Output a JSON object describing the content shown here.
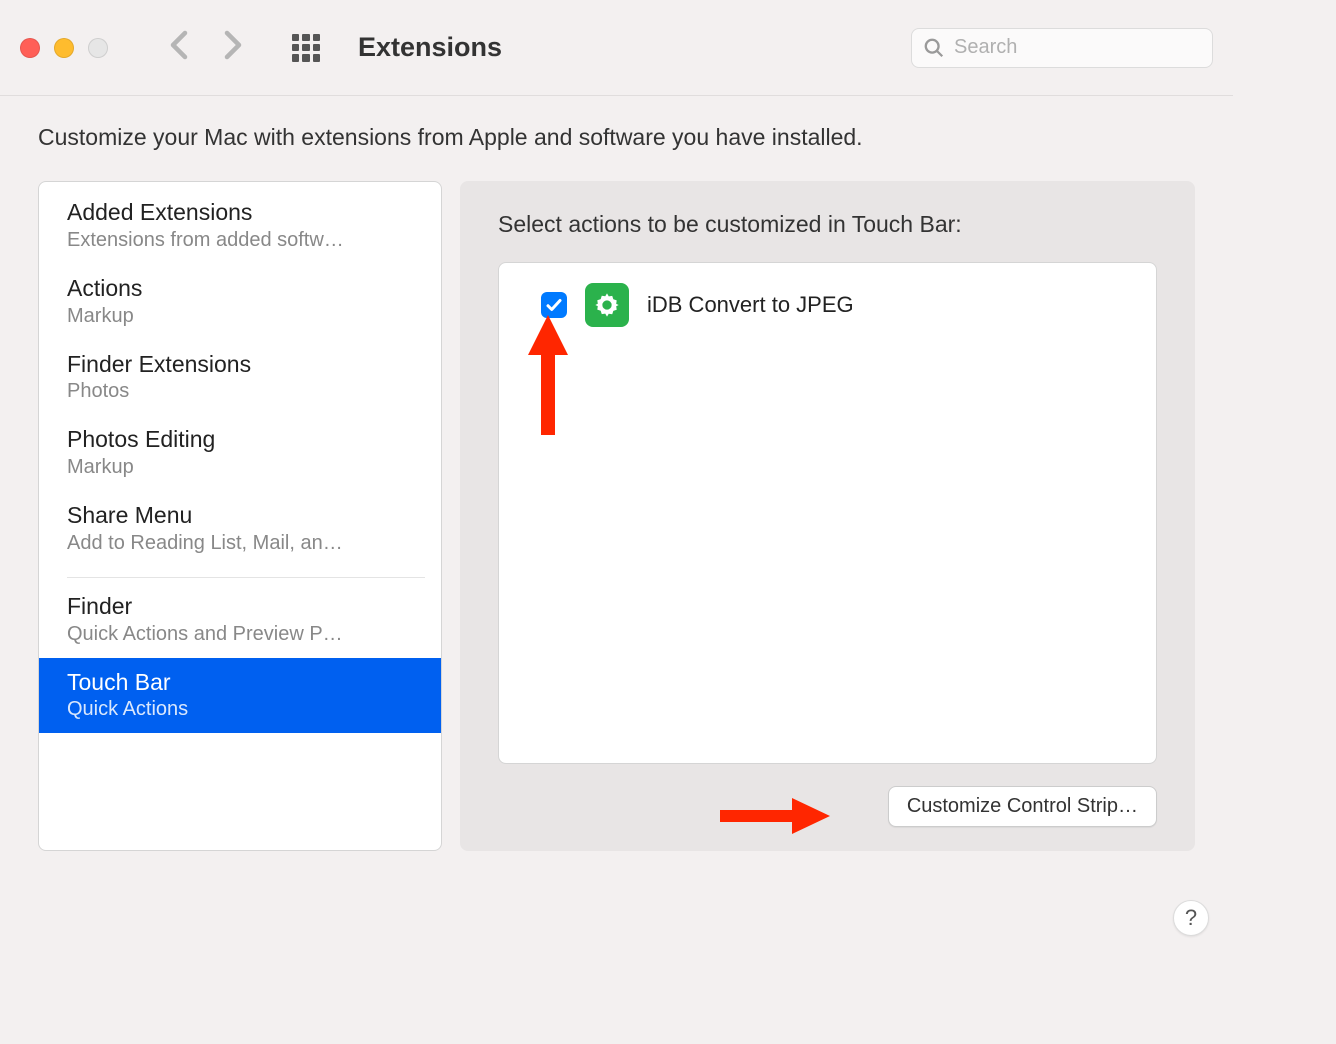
{
  "header": {
    "title": "Extensions",
    "search_placeholder": "Search"
  },
  "intro": "Customize your Mac with extensions from Apple and software you have installed.",
  "sidebar": {
    "items": [
      {
        "title": "Added Extensions",
        "sub": "Extensions from added softw…"
      },
      {
        "title": "Actions",
        "sub": "Markup"
      },
      {
        "title": "Finder Extensions",
        "sub": "Photos"
      },
      {
        "title": "Photos Editing",
        "sub": "Markup"
      },
      {
        "title": "Share Menu",
        "sub": "Add to Reading List, Mail, an…"
      },
      {
        "title": "Finder",
        "sub": "Quick Actions and Preview P…"
      },
      {
        "title": "Touch Bar",
        "sub": "Quick Actions"
      }
    ],
    "selected_index": 6,
    "separator_before_index": 5
  },
  "right": {
    "heading": "Select actions to be customized in Touch Bar:",
    "actions": [
      {
        "checked": true,
        "label": "iDB Convert to JPEG",
        "icon": "gear-automator"
      }
    ],
    "button_label": "Customize Control Strip…"
  },
  "help_label": "?"
}
